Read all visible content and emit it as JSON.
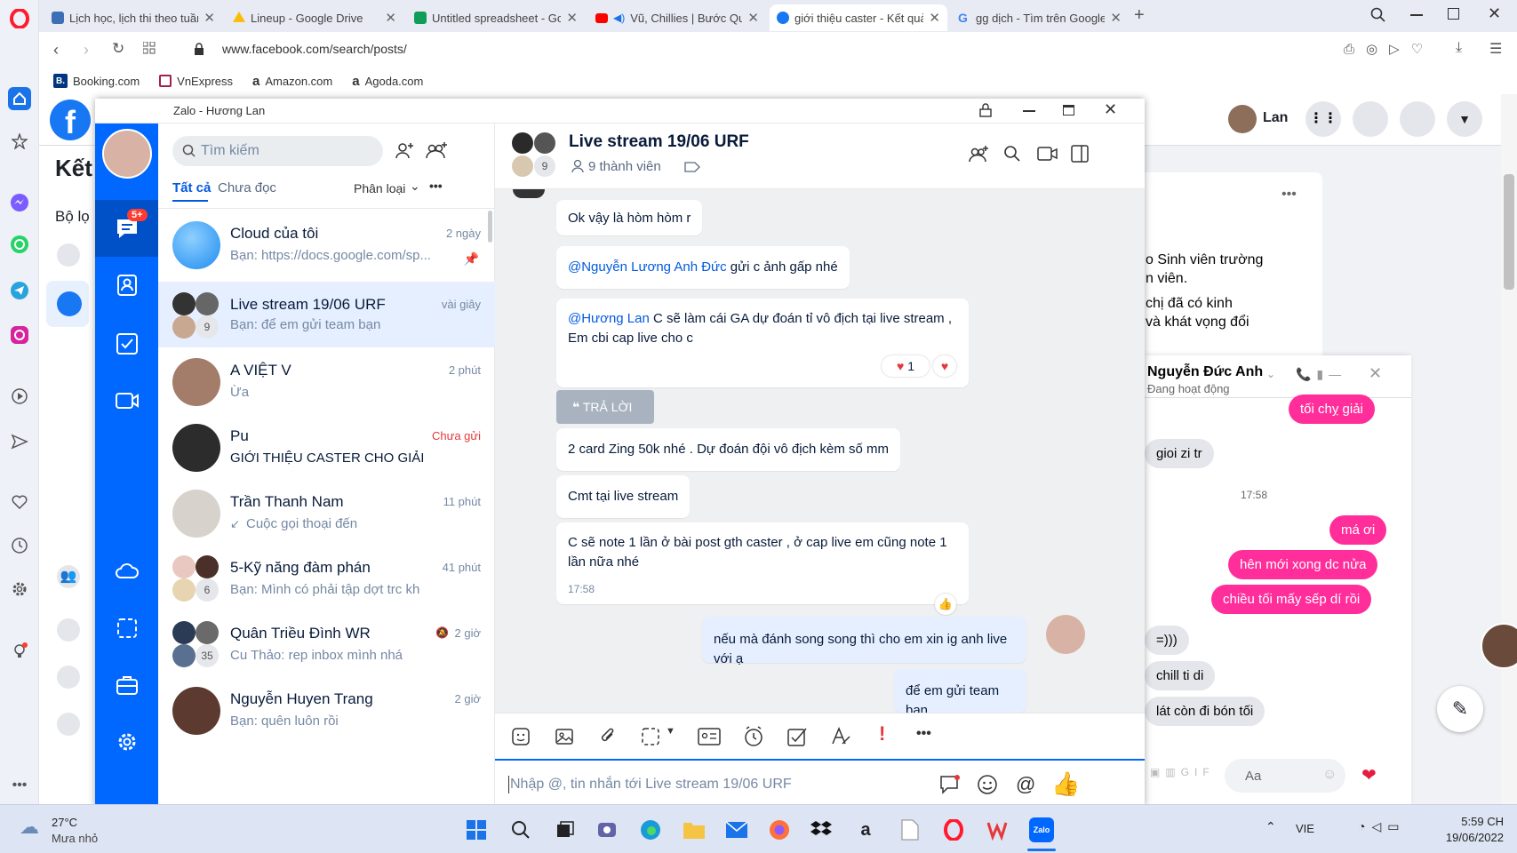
{
  "browser": {
    "tabs": [
      {
        "label": "Lịch học, lịch thi theo tuần",
        "favicon_color": "#3d6fb5"
      },
      {
        "label": "Lineup - Google Drive",
        "favicon_color": "#fbbc04"
      },
      {
        "label": "Untitled spreadsheet - Goo",
        "favicon_color": "#0f9d58"
      },
      {
        "label": "Vũ, Chillies | Bước Qua",
        "favicon_color": "#ff0000"
      },
      {
        "label": "giới thiệu caster - Kết quả t",
        "favicon_color": "#1877f2"
      },
      {
        "label": "gg dịch - Tìm trên Google",
        "favicon_color": "#4285f4"
      }
    ],
    "url": "www.facebook.com/search/posts/",
    "bookmarks": [
      "Booking.com",
      "VnExpress",
      "Amazon.com",
      "Agoda.com"
    ]
  },
  "facebook": {
    "heading_partial": "Kết",
    "filter_partial": "Bộ lọ",
    "user_name": "Lan",
    "post_text_lines": [
      "o Sinh viên trường",
      "n viên.",
      "chị đã có kinh",
      "và khát vọng đổi"
    ],
    "messenger": {
      "contact_name": "Nguyễn Đức Anh",
      "status": "Đang hoạt động",
      "timestamp": "17:58",
      "messages": [
        {
          "text": "tối chỵ giải",
          "from": "me"
        },
        {
          "text": "gioi zi tr",
          "from": "them"
        },
        {
          "text": "má ơi",
          "from": "me"
        },
        {
          "text": "hên mới xong dc nửa",
          "from": "me"
        },
        {
          "text": "chiều tối mấy sếp dí rồi",
          "from": "me"
        },
        {
          "text": "=)))",
          "from": "them"
        },
        {
          "text": "chill ti di",
          "from": "them"
        },
        {
          "text": "lát còn đi bón tối",
          "from": "them"
        }
      ],
      "input_placeholder": "Aa"
    }
  },
  "zalo": {
    "window_title": "Zalo - Hương Lan",
    "rail_badge": "5+",
    "search_placeholder": "Tìm kiếm",
    "filters": {
      "all": "Tất cả",
      "unread": "Chưa đọc",
      "classify": "Phân loại"
    },
    "conversations": [
      {
        "name": "Cloud của tôi",
        "preview": "Bạn: https://docs.google.com/sp...",
        "time": "2 ngày"
      },
      {
        "name": "Live stream 19/06 URF",
        "preview": "Bạn: để em gửi team bạn",
        "time": "vài giây",
        "count": "9"
      },
      {
        "name": "A VIỆT V",
        "preview": "Ừa",
        "time": "2 phút"
      },
      {
        "name": "Pu",
        "preview": "GIỚI THIỆU CASTER CHO GIẢI",
        "time": "Chưa gửi"
      },
      {
        "name": "Trần Thanh Nam",
        "preview": "Cuộc gọi thoại đến",
        "time": "11 phút"
      },
      {
        "name": "5-Kỹ năng đàm phán",
        "preview": "Bạn: Mình có phải tập dợt trc kh",
        "time": "41 phút",
        "count": "6"
      },
      {
        "name": "Quân Triều Đình WR",
        "preview": "Cu Thảo: rep inbox mình nhá",
        "time": "2 giờ",
        "count": "35"
      },
      {
        "name": "Nguyễn Huyen Trang",
        "preview": "Bạn: quên luôn rồi",
        "time": "2 giờ"
      }
    ],
    "chat": {
      "title": "Live stream 19/06 URF",
      "members": "9 thành viên",
      "avatar_count": "9",
      "messages": [
        {
          "text": "Ok vậy là hòm hòm r"
        },
        {
          "mention": "@Nguyễn Lương Anh Đức",
          "text": " gửi c ảnh gấp nhé"
        },
        {
          "mention": "@Hương Lan",
          "text": " C sẽ làm cái GA dự đoán tỉ vô địch tại live stream , Em cbi cap live cho c",
          "reaction_count": "1"
        },
        {
          "text": "2 card Zing 50k nhé .  Dự đoán đội vô địch kèm số mm"
        },
        {
          "text": "Cmt tại live stream"
        },
        {
          "text": "C sẽ note 1 lần ở bài post gth caster ,  ở cap live em cũng note 1 lần nữa nhé",
          "time": "17:58"
        },
        {
          "text": "nếu mà đánh song song thì cho em xin ig anh live với ạ",
          "from": "me"
        },
        {
          "text": "để em gửi team bạn",
          "from": "me"
        }
      ],
      "reply_label": "TRẢ LỜI",
      "input_placeholder": "Nhập @, tin nhắn tới Live stream 19/06 URF"
    }
  },
  "taskbar": {
    "weather_temp": "27°C",
    "weather_desc": "Mưa nhỏ",
    "language": "VIE",
    "time": "5:59 CH",
    "date": "19/06/2022"
  }
}
